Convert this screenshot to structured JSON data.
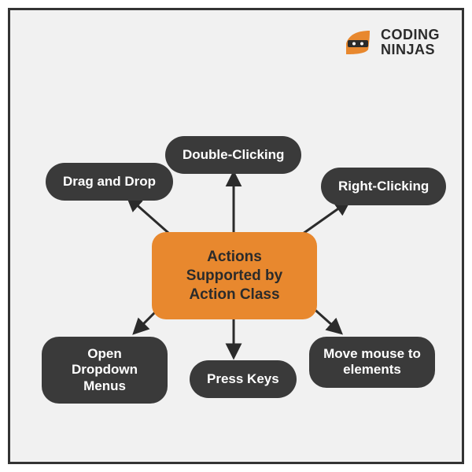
{
  "logo": {
    "line1": "CODING",
    "line2": "NINJAS"
  },
  "diagram": {
    "center": "Actions Supported by Action Class",
    "nodes": {
      "top": "Double-Clicking",
      "top_left": "Drag and Drop",
      "top_right": "Right-Clicking",
      "bottom_left": "Open Dropdown Menus",
      "bottom": "Press Keys",
      "bottom_right": "Move mouse to elements"
    }
  },
  "colors": {
    "accent": "#e8882e",
    "node_bg": "#3a3a3a",
    "node_fg": "#ffffff",
    "frame": "#333333",
    "bg": "#f1f1f1"
  }
}
